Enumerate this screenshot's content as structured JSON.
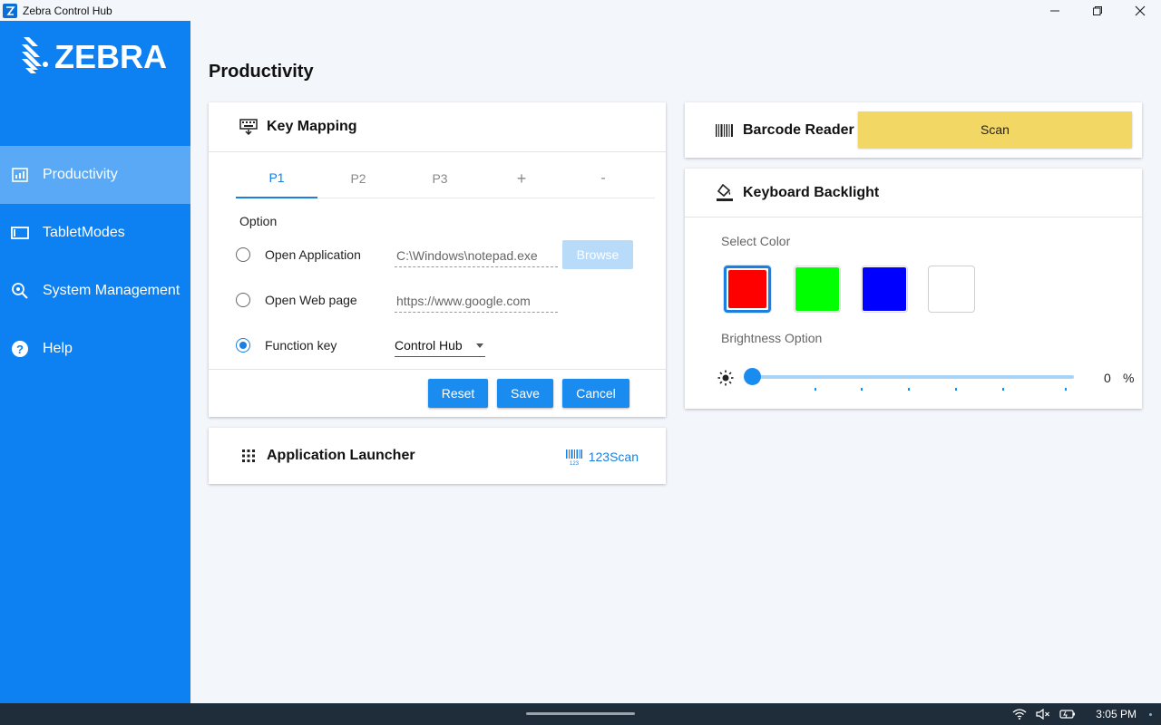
{
  "window": {
    "title": "Zebra Control Hub"
  },
  "sidebar": {
    "logo_text": "ZEBRA",
    "items": [
      {
        "label": "Productivity",
        "icon": "chart-icon",
        "active": true
      },
      {
        "label": "TabletModes",
        "icon": "tablet-icon",
        "active": false
      },
      {
        "label": "System Management",
        "icon": "search-gear-icon",
        "active": false
      },
      {
        "label": "Help",
        "icon": "help-icon",
        "active": false
      }
    ]
  },
  "page": {
    "title": "Productivity"
  },
  "key_mapping": {
    "title": "Key Mapping",
    "tabs": [
      "P1",
      "P2",
      "P3",
      "+",
      "-"
    ],
    "active_tab": "P1",
    "option_label": "Option",
    "options": [
      {
        "label": "Open Application",
        "value": "C:\\Windows\\notepad.exe",
        "selected": false
      },
      {
        "label": "Open Web page",
        "value": "https://www.google.com",
        "selected": false
      },
      {
        "label": "Function key",
        "value": "Control Hub",
        "selected": true
      }
    ],
    "browse_label": "Browse",
    "buttons": {
      "reset": "Reset",
      "save": "Save",
      "cancel": "Cancel"
    }
  },
  "app_launcher": {
    "title": "Application Launcher",
    "app_label": "123Scan"
  },
  "barcode_reader": {
    "title": "Barcode Reader",
    "scan_label": "Scan"
  },
  "keyboard_backlight": {
    "title": "Keyboard Backlight",
    "select_color_label": "Select Color",
    "colors": [
      "#ff0000",
      "#00ff00",
      "#0000ff",
      "#ffffff"
    ],
    "selected_color": "#ff0000",
    "brightness_label": "Brightness Option",
    "brightness_value": "0",
    "brightness_unit": "%"
  },
  "taskbar": {
    "time": "3:05 PM"
  },
  "colors": {
    "sidebar": "#0d80f2",
    "active_nav": "#5aa9f6",
    "accent": "#1a8cf0",
    "scan_button": "#f3d764"
  }
}
